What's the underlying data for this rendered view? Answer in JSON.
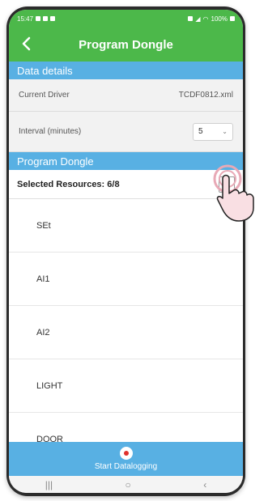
{
  "status_bar": {
    "time": "15:47",
    "battery": "100%"
  },
  "header": {
    "title": "Program Dongle"
  },
  "sections": {
    "data_details": "Data details",
    "program_dongle": "Program Dongle"
  },
  "data_details": {
    "current_driver_label": "Current Driver",
    "current_driver_value": "TCDF0812.xml",
    "interval_label": "Interval (minutes)",
    "interval_value": "5"
  },
  "resources": {
    "selected_label": "Selected Resources: 6/8",
    "items": [
      "SEt",
      "AI1",
      "AI2",
      "LIGHT",
      "DOOR"
    ]
  },
  "bottom": {
    "start_label": "Start Datalogging"
  },
  "colors": {
    "green": "#4cb84a",
    "blue": "#58b0e3",
    "record": "#e0312d"
  }
}
